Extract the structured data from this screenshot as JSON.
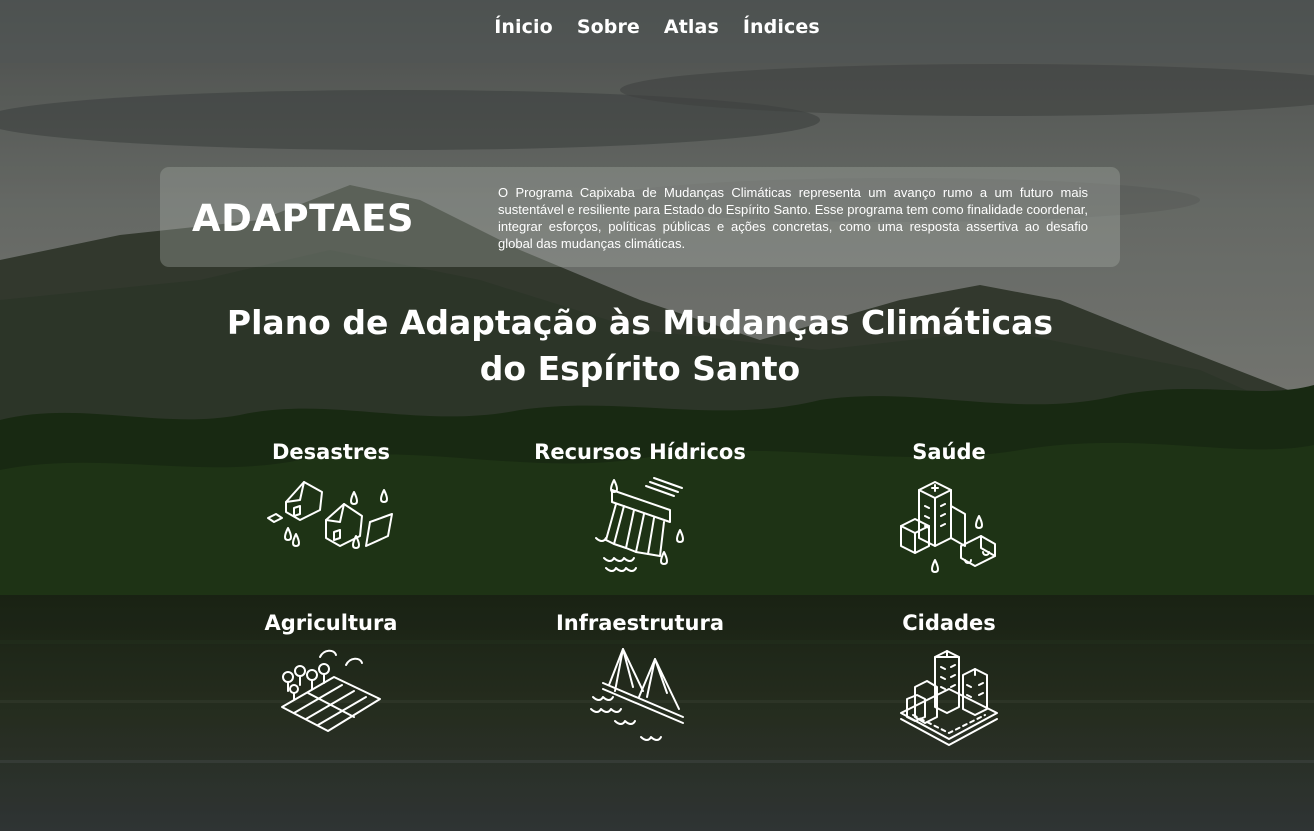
{
  "nav": {
    "items": [
      {
        "label": "Ínicio"
      },
      {
        "label": "Sobre"
      },
      {
        "label": "Atlas"
      },
      {
        "label": "Índices"
      }
    ]
  },
  "hero": {
    "brand": "ADAPTAES",
    "description": "O Programa Capixaba de Mudanças Climáticas representa um avanço rumo a um futuro mais sustentável e resiliente para Estado do Espírito Santo. Esse programa tem como finalidade coordenar, integrar esforços, políticas públicas e ações concretas, como uma resposta assertiva ao desafio global das mudanças climáticas."
  },
  "main": {
    "title_line1": "Plano de Adaptação às Mudanças Climáticas",
    "title_line2": "do Espírito Santo",
    "cards": [
      {
        "label": "Desastres",
        "icon": "disasters-icon"
      },
      {
        "label": "Recursos Hídricos",
        "icon": "water-dam-icon"
      },
      {
        "label": "Saúde",
        "icon": "hospital-ambulance-icon"
      },
      {
        "label": "Agricultura",
        "icon": "farm-field-icon"
      },
      {
        "label": "Infraestrutura",
        "icon": "bridge-icon"
      },
      {
        "label": "Cidades",
        "icon": "city-buildings-icon"
      }
    ]
  },
  "colors": {
    "text": "#ffffff",
    "nav_overlay": "#50565a",
    "card_overlay": "#aaafaa"
  }
}
